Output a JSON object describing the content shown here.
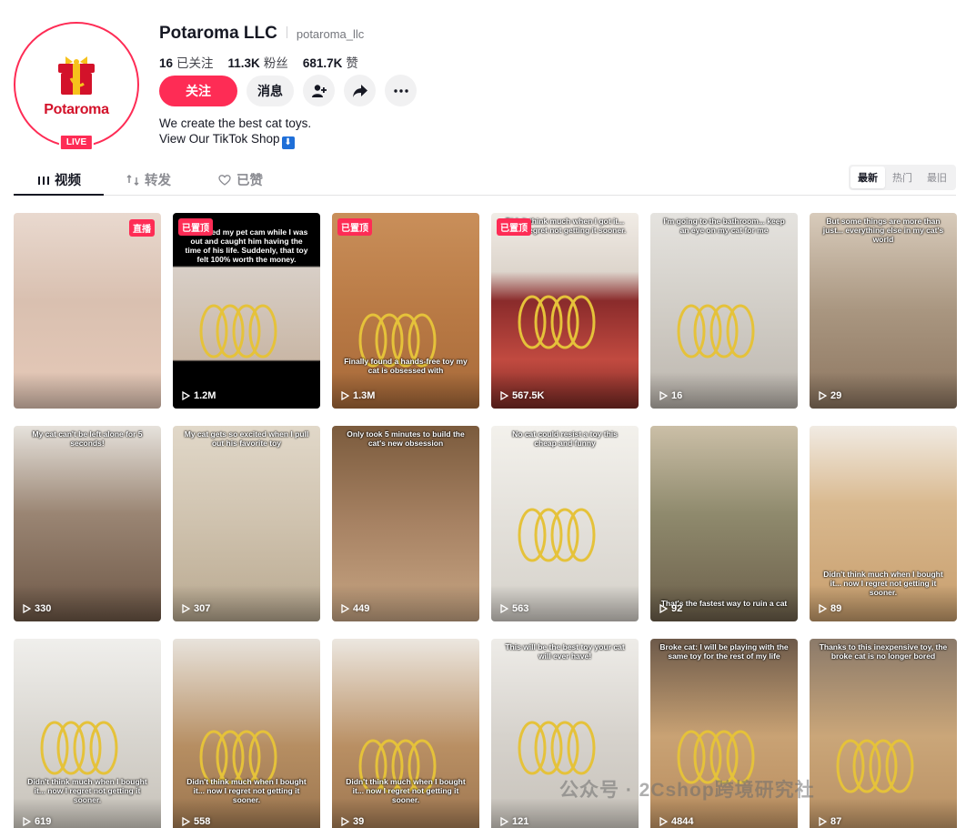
{
  "profile": {
    "display_name": "Potaroma LLC",
    "handle": "potaroma_llc",
    "logo_text": "Potaroma",
    "live_label": "LIVE",
    "bio_line1": "We create the best cat toys.",
    "bio_line2": "View Our TikTok Shop",
    "shop_icon_glyph": "⬇"
  },
  "stats": {
    "following_count": "16",
    "following_label": "已关注",
    "followers_count": "11.3K",
    "followers_label": "粉丝",
    "likes_count": "681.7K",
    "likes_label": "赞"
  },
  "actions": {
    "follow_label": "关注",
    "message_label": "消息"
  },
  "tabs": {
    "videos": "视频",
    "reposts": "转发",
    "liked": "已赞"
  },
  "sort": {
    "latest": "最新",
    "popular": "热门",
    "oldest": "最旧"
  },
  "colors": {
    "accent": "#fe2c55",
    "text": "#161823",
    "muted": "#8a8b91"
  },
  "videos": [
    {
      "views": "",
      "caption": "",
      "badge": "直播"
    },
    {
      "views": "1.2M",
      "caption": "I checked my pet cam while I was out and caught him having the time of his life. Suddenly, that toy felt 100% worth the money.",
      "badge": "已置顶"
    },
    {
      "views": "1.3M",
      "caption": "Finally found a hands-free toy my cat is obsessed with",
      "badge": "已置顶"
    },
    {
      "views": "567.5K",
      "caption": "Didn't think much when I got it... now I regret not getting it sooner.",
      "badge": "已置顶"
    },
    {
      "views": "16",
      "caption": "I'm going to the bathroom... keep an eye on my cat for me",
      "badge": ""
    },
    {
      "views": "29",
      "caption": "But some things are more than just... everything else in my cat's world",
      "badge": ""
    },
    {
      "views": "330",
      "caption": "My cat can't be left alone for 5 seconds!",
      "badge": ""
    },
    {
      "views": "307",
      "caption": "My cat gets so excited when I pull out his favorite toy",
      "badge": ""
    },
    {
      "views": "449",
      "caption": "Only took 5 minutes to build the cat's new obsession",
      "badge": ""
    },
    {
      "views": "563",
      "caption": "No cat could resist a toy this cheap and funny",
      "badge": ""
    },
    {
      "views": "92",
      "caption": "That's the fastest way to ruin a cat",
      "badge": ""
    },
    {
      "views": "89",
      "caption": "Didn't think much when I bought it... now I regret not getting it sooner.",
      "badge": ""
    },
    {
      "views": "619",
      "caption": "Didn't think much when I bought it... now I regret not getting it sooner.",
      "badge": ""
    },
    {
      "views": "558",
      "caption": "Didn't think much when I bought it... now I regret not getting it sooner.",
      "badge": ""
    },
    {
      "views": "39",
      "caption": "Didn't think much when I bought it... now I regret not getting it sooner.",
      "badge": ""
    },
    {
      "views": "121",
      "caption": "This will be the best toy your cat will ever have!",
      "badge": ""
    },
    {
      "views": "4844",
      "caption": "Broke cat: I will be playing with the same toy for the rest of my life",
      "badge": ""
    },
    {
      "views": "87",
      "caption": "Thanks to this inexpensive toy, the broke cat is no longer bored",
      "badge": ""
    }
  ],
  "watermark": "公众号 · 2Cshop跨境研究社"
}
